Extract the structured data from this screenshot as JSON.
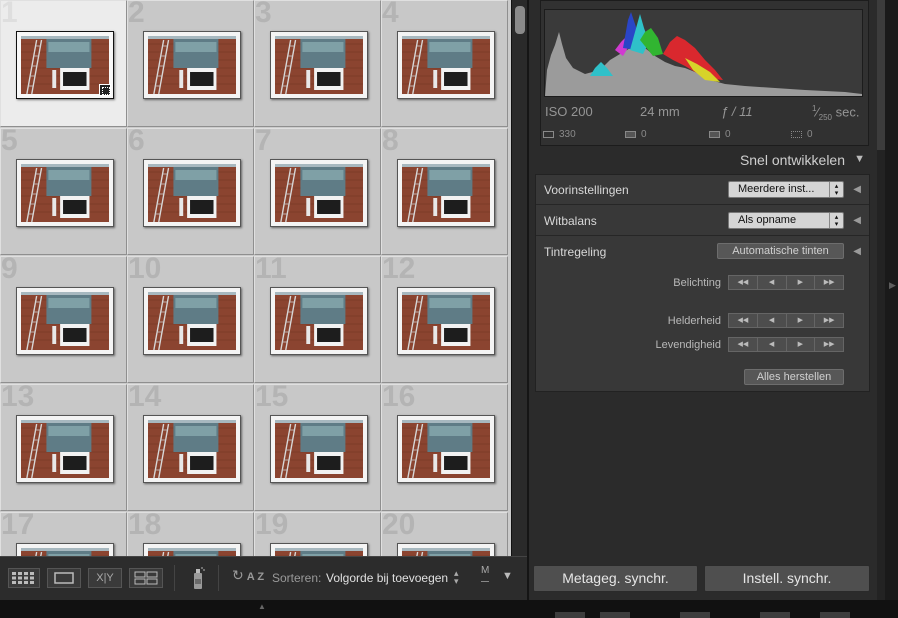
{
  "grid": {
    "cells": [
      {
        "index": "1",
        "selected": true
      },
      {
        "index": "2"
      },
      {
        "index": "3"
      },
      {
        "index": "4"
      },
      {
        "index": "5"
      },
      {
        "index": "6"
      },
      {
        "index": "7"
      },
      {
        "index": "8"
      },
      {
        "index": "9"
      },
      {
        "index": "10"
      },
      {
        "index": "11"
      },
      {
        "index": "12"
      },
      {
        "index": "13"
      },
      {
        "index": "14"
      },
      {
        "index": "15"
      },
      {
        "index": "16"
      },
      {
        "index": "17"
      },
      {
        "index": "18"
      },
      {
        "index": "19"
      },
      {
        "index": "20"
      }
    ]
  },
  "toolbar": {
    "grid_view_icon": "grid-view-icon",
    "loupe_view_icon": "loupe-view-icon",
    "compare_view_label": "X|Y",
    "survey_view_icon": "survey-view-icon",
    "spray_can_icon": "painter-spray-icon",
    "sort_direction_label": "A Z",
    "sort_label": "Sorteren:",
    "sort_value": "Volgorde bij toevoegen",
    "thumbnail_size_label": "M",
    "menu_icon": "chevron-down-icon"
  },
  "histogram": {
    "iso": "ISO 200",
    "focal_length": "24 mm",
    "aperture": "ƒ / 11",
    "shutter_num": "1",
    "shutter_den": "250",
    "shutter_unit": "sec.",
    "stat1": "330",
    "stat2": "0",
    "stat3": "0",
    "stat4": "0"
  },
  "quick_develop": {
    "title": "Snel ontwikkelen",
    "preset_label": "Voorinstellingen",
    "preset_value": "Meerdere inst...",
    "wb_label": "Witbalans",
    "wb_value": "Als opname",
    "tone_label": "Tintregeling",
    "auto_tone_label": "Automatische tinten",
    "exposure_label": "Belichting",
    "clarity_label": "Helderheid",
    "vibrance_label": "Levendigheid",
    "reset_label": "Alles herstellen"
  },
  "sync": {
    "metadata_label": "Metageg. synchr.",
    "settings_label": "Instell. synchr."
  },
  "colors": {
    "grid_bg": "#cbcbcb",
    "panel_bg": "#2b2b2b",
    "hist_red": "#d9282e",
    "hist_green": "#31b531",
    "hist_blue": "#2a45c7",
    "hist_cyan": "#2fc1c9",
    "hist_magenta": "#d13ad1",
    "hist_yellow": "#d7d32a",
    "hist_gray": "#9b9b9b"
  }
}
